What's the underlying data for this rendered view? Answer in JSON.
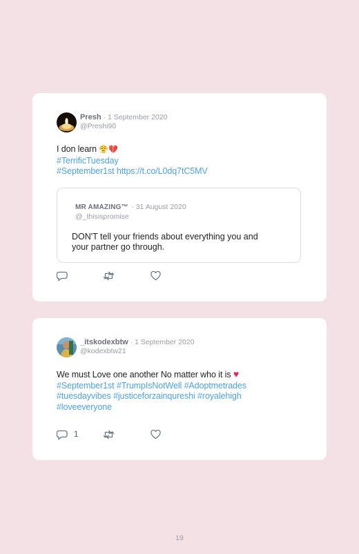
{
  "tweets": [
    {
      "name": "Presh",
      "date": "· 1 September 2020",
      "handle": "@Preshi90",
      "text": "I don learn",
      "emoji": "😤💔",
      "tags_line1": "#TerrificTuesday",
      "tags_line2": "#September1st https://t.co/L0dq7tC5MV",
      "quote": {
        "name": "MR AMAZING™",
        "date": "· 31 August 2020",
        "handle": "@_thisispromise",
        "text_line1": "DON'T tell your friends about everything you and",
        "text_line2": "your partner go through."
      },
      "reply_count": ""
    },
    {
      "name": "_itskodexbtw",
      "date": "· 1 September 2020",
      "handle": "@kodexbtw21",
      "text": "We must Love one another No matter who it is",
      "emoji": "♥",
      "tags_line1": "#September1st #TrumpIsNotWell #Adoptmetrades",
      "tags_line2": "#tuesdayvibes #justiceforzainqureshi #royalehigh",
      "tags_line3": "#loveeveryone",
      "reply_count": "1"
    }
  ],
  "page_number": "19",
  "colors": {
    "background": "#f4e1e5",
    "card": "#ffffff",
    "link": "#4aa3e6",
    "heart": "#e0245e"
  }
}
